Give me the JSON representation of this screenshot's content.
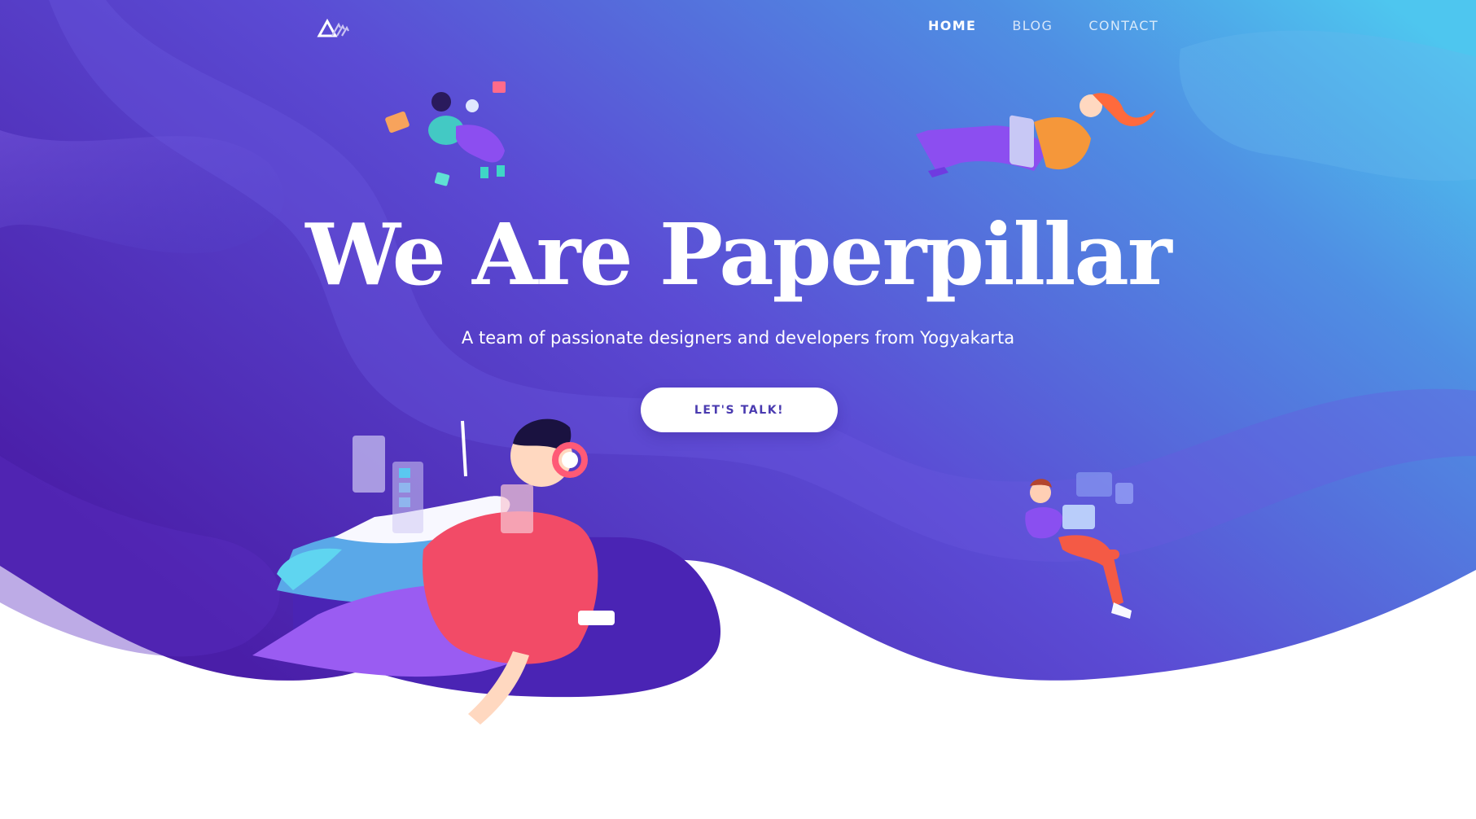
{
  "nav": {
    "logo_icon": "paperpillar-logo-icon",
    "links": [
      {
        "label": "HOME",
        "active": true
      },
      {
        "label": "BLOG",
        "active": false
      },
      {
        "label": "CONTACT",
        "active": false
      }
    ]
  },
  "hero": {
    "title": "We Are Paperpillar",
    "subtitle": "A team of passionate designers and developers from Yogyakarta",
    "cta_label": "LET'S TALK!"
  },
  "colors": {
    "gradient_start": "#4b1fb0",
    "gradient_mid": "#5a4fd6",
    "gradient_end": "#4fc3ee",
    "accent_red": "#f24b67",
    "accent_purple": "#9a5cf2",
    "cta_text": "#4a3bb0"
  }
}
